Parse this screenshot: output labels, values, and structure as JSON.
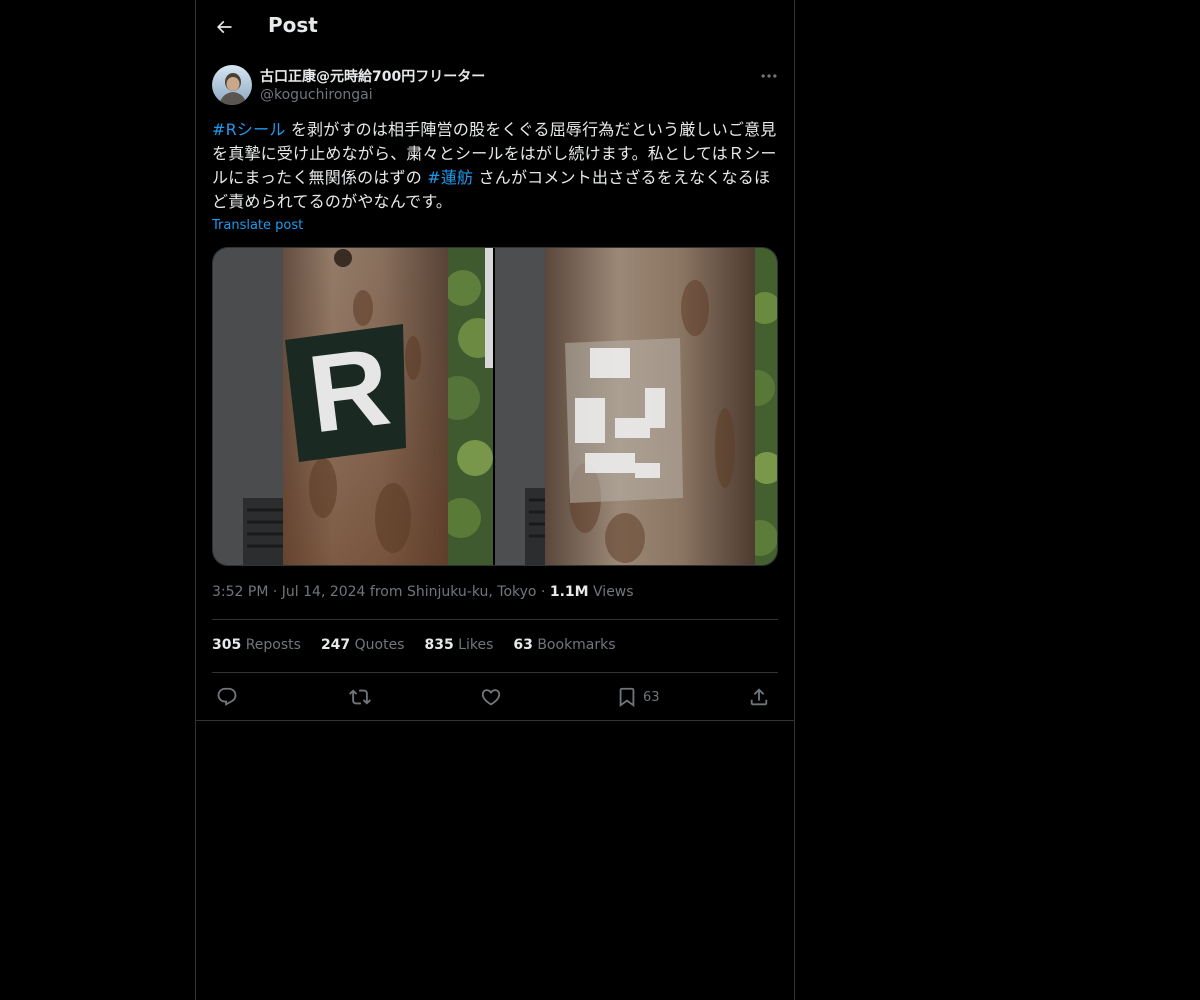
{
  "header": {
    "title": "Post",
    "back_icon": "arrow-left-icon"
  },
  "author": {
    "display_name": "古口正康@元時給700円フリーター",
    "handle": "@koguchirongai"
  },
  "post": {
    "segments": [
      {
        "text": "#Rシール",
        "hashtag": true
      },
      {
        "text": " を剥がすのは相手陣営の股をくぐる屈辱行為だという厳しいご意見を真摯に受け止めながら、粛々とシールをはがし続けます。私としてはＲシールにまったく無関係のはずの ",
        "hashtag": false
      },
      {
        "text": "#蓮舫",
        "hashtag": true
      },
      {
        "text": " さんがコメント出さざるをえなくなるほど責められてるのがやなんです。",
        "hashtag": false
      }
    ],
    "translate_label": "Translate post",
    "sticker_letter": "R"
  },
  "meta": {
    "time": "3:52 PM",
    "sep1": "·",
    "date_location": "Jul 14, 2024 from Shinjuku-ku, Tokyo",
    "sep2": "·",
    "views_count": "1.1M",
    "views_label": "Views"
  },
  "stats": {
    "reposts_count": "305",
    "reposts_label": "Reposts",
    "quotes_count": "247",
    "quotes_label": "Quotes",
    "likes_count": "835",
    "likes_label": "Likes",
    "bookmarks_count": "63",
    "bookmarks_label": "Bookmarks"
  },
  "actions": {
    "reply_icon": "reply-icon",
    "repost_icon": "repost-icon",
    "like_icon": "heart-icon",
    "bookmark_icon": "bookmark-icon",
    "bookmark_count": "63",
    "share_icon": "share-icon"
  },
  "colors": {
    "background": "#000000",
    "text": "#e7e9ea",
    "secondary": "#71767b",
    "accent": "#1d9bf0",
    "border": "#2f3336"
  }
}
